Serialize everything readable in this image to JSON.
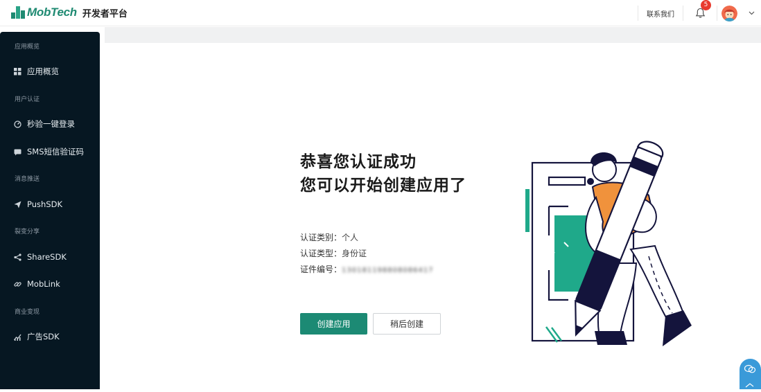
{
  "header": {
    "brand": "MobTech",
    "subtitle": "开发者平台",
    "contact_label": "联系我们",
    "notification_count": "5"
  },
  "sidebar": {
    "groups": [
      {
        "label": "应用概览",
        "items": [
          {
            "label": "应用概览",
            "icon": "grid-icon"
          }
        ]
      },
      {
        "label": "用户认证",
        "items": [
          {
            "label": "秒验一键登录",
            "icon": "gauge-icon"
          },
          {
            "label": "SMS短信验证码",
            "icon": "sms-icon"
          }
        ]
      },
      {
        "label": "消息推送",
        "items": [
          {
            "label": "PushSDK",
            "icon": "send-icon"
          }
        ]
      },
      {
        "label": "裂变分享",
        "items": [
          {
            "label": "ShareSDK",
            "icon": "share-icon"
          },
          {
            "label": "MobLink",
            "icon": "link-icon"
          }
        ]
      },
      {
        "label": "商业变现",
        "items": [
          {
            "label": "广告SDK",
            "icon": "chart-icon"
          }
        ]
      }
    ]
  },
  "main": {
    "title_line1": "恭喜您认证成功",
    "title_line2": "您可以开始创建应用了",
    "info": [
      {
        "label": "认证类别：",
        "value": "个人"
      },
      {
        "label": "认证类型：",
        "value": "身份证"
      },
      {
        "label": "证件编号：",
        "value": "130181198808086417"
      }
    ],
    "primary_button": "创建应用",
    "secondary_button": "稍后创建"
  },
  "colors": {
    "brand": "#1f8a72",
    "primary_button": "#1c8a74",
    "sidebar_bg": "#061722",
    "badge": "#e83a2e",
    "illustration_accent": "#f0923c",
    "illustration_green": "#1fa98a",
    "illustration_navy": "#14143c"
  }
}
